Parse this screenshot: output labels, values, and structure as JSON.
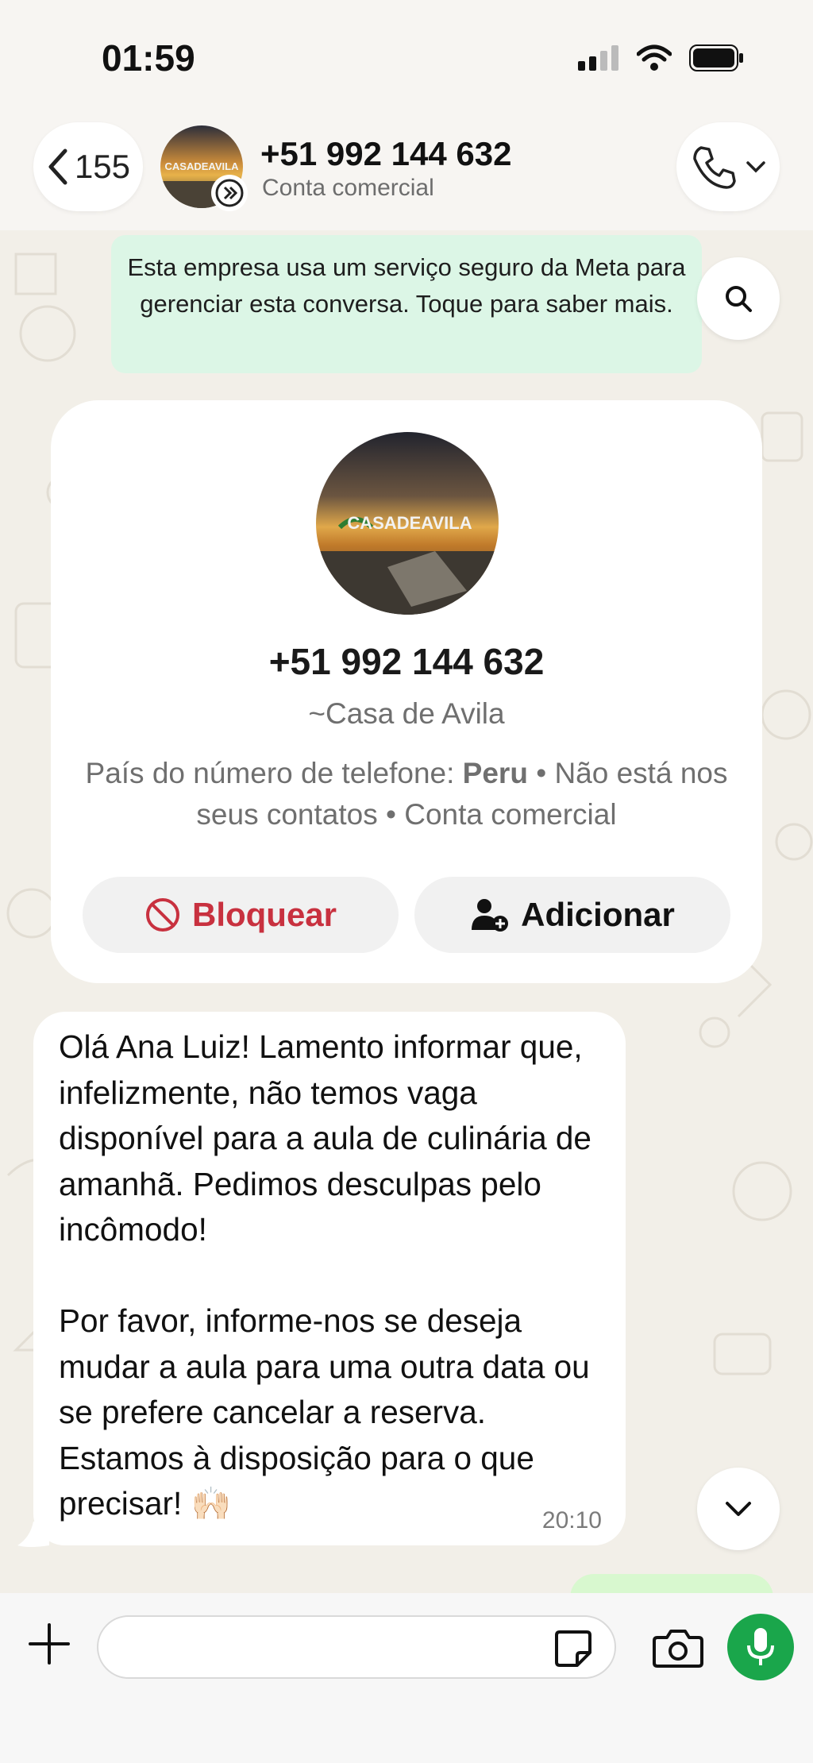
{
  "status_bar": {
    "time": "01:59"
  },
  "header": {
    "back_count": "155",
    "title": "+51 992 144 632",
    "subtitle": "Conta comercial"
  },
  "notice": {
    "text": "Esta empresa usa um serviço seguro da Meta para gerenciar esta conversa. Toque para saber mais."
  },
  "contact_card": {
    "phone": "+51 992 144 632",
    "name": "~Casa de Avila",
    "info_prefix": "País do número de telefone: ",
    "country": "Peru",
    "info_suffix": " • Não está nos seus contatos • Conta comercial",
    "block_label": "Bloquear",
    "add_label": "Adicionar",
    "logo_text": "CASADEAVILA"
  },
  "message": {
    "text": "Olá Ana Luiz! Lamento informar que, infelizmente, não temos vaga disponível para a aula de culinária de amanhã. Pedimos desculpas pelo incômodo!\n\nPor favor, informe-nos se deseja mudar a aula para uma outra data ou se prefere cancelar a reserva. Estamos à disposição para o que precisar! 🙌🏻",
    "time": "20:10"
  },
  "composer": {
    "placeholder": ""
  },
  "colors": {
    "block_red": "#c8313f",
    "mic_green": "#1aa64b",
    "notice_bg": "#dcf6e6",
    "chat_bg": "#f2efe8"
  },
  "icons": {
    "back": "chevron-left-icon",
    "call": "phone-icon",
    "search": "search-icon",
    "block": "block-icon",
    "add": "add-contact-icon",
    "scroll_down": "chevron-down-icon",
    "plus": "plus-icon",
    "sticker": "sticker-icon",
    "camera": "camera-icon",
    "mic": "microphone-icon"
  }
}
